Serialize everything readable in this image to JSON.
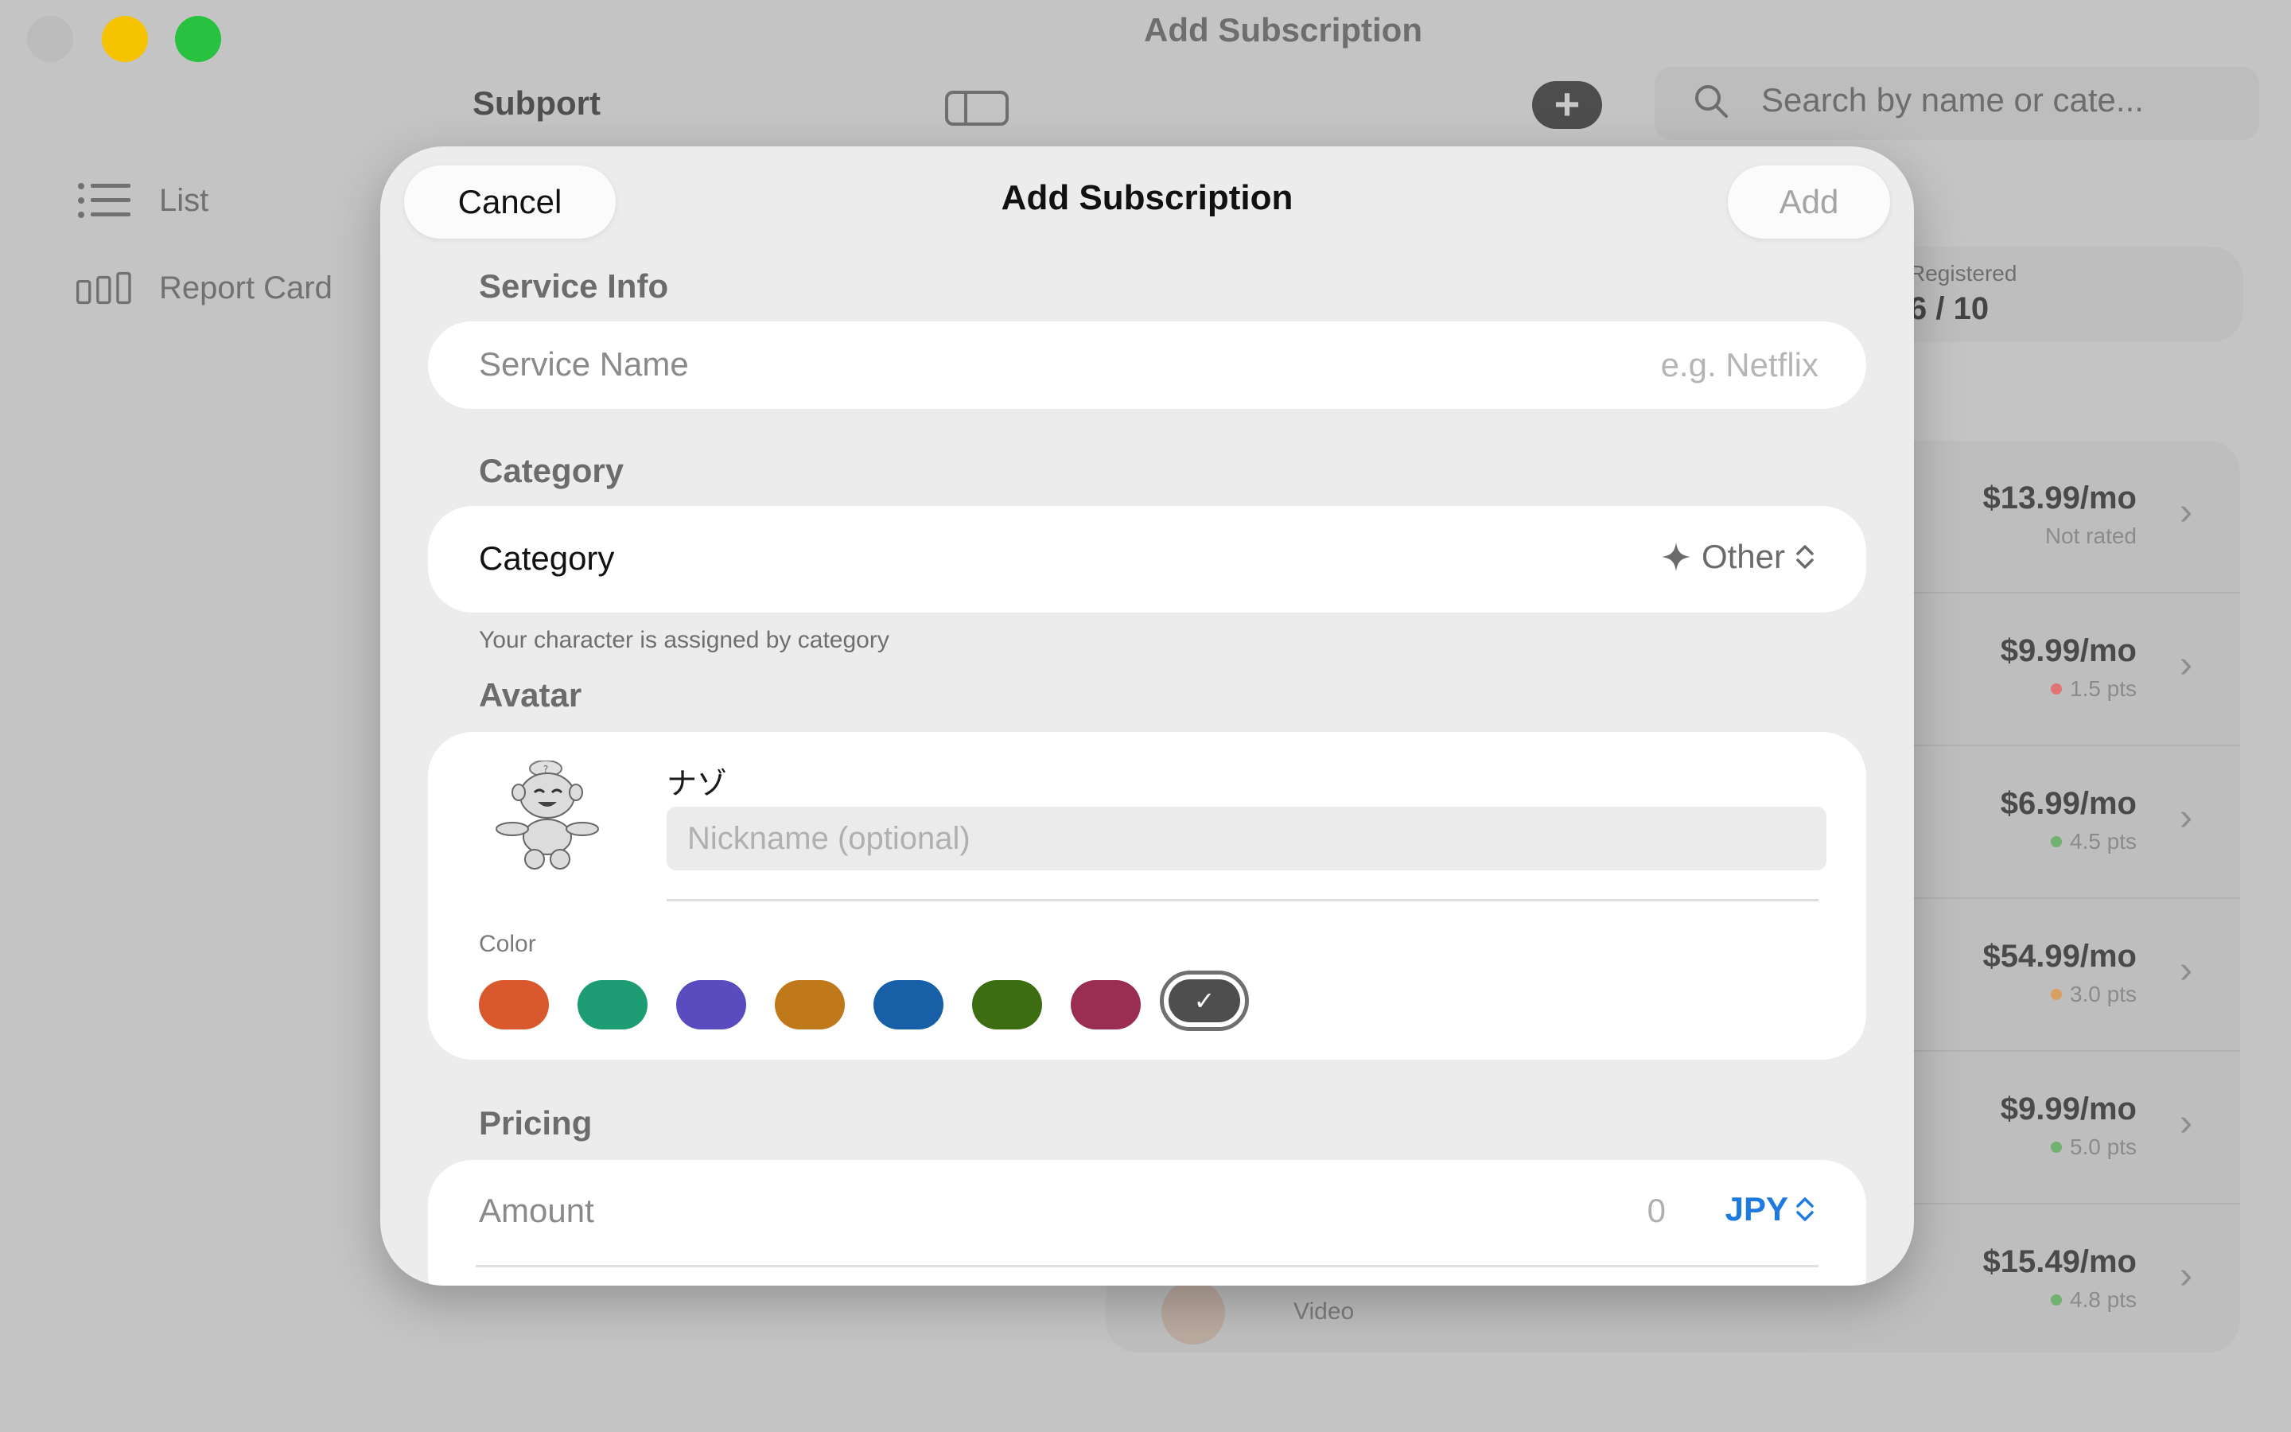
{
  "window": {
    "title": "Add Subscription"
  },
  "toolbar": {
    "app_name": "Subport",
    "search_placeholder": "Search by name or cate..."
  },
  "sidebar": {
    "items": [
      {
        "label": "List"
      },
      {
        "label": "Report Card"
      }
    ]
  },
  "stats": {
    "label": "Registered",
    "value": "6 / 10"
  },
  "subscriptions": [
    {
      "price": "$13.99/mo",
      "rating": "Not rated",
      "dot_color": ""
    },
    {
      "price": "$9.99/mo",
      "rating": "1.5 pts",
      "dot_color": "#e07474"
    },
    {
      "price": "$6.99/mo",
      "rating": "4.5 pts",
      "dot_color": "#6fb36f"
    },
    {
      "price": "$54.99/mo",
      "rating": "3.0 pts",
      "dot_color": "#d9a062"
    },
    {
      "price": "$9.99/mo",
      "rating": "5.0 pts",
      "dot_color": "#6fb36f"
    },
    {
      "price": "$15.49/mo",
      "rating": "4.8 pts",
      "dot_color": "#6fb36f",
      "category": "Video"
    }
  ],
  "modal": {
    "title": "Add Subscription",
    "cancel_label": "Cancel",
    "add_label": "Add",
    "service_info": {
      "section_title": "Service Info",
      "name_label": "Service Name",
      "name_value": "",
      "name_placeholder": "e.g. Netflix"
    },
    "category": {
      "section_title": "Category",
      "label": "Category",
      "selected": "Other",
      "selected_icon": "sparkle-icon",
      "note": "Your character is assigned by category"
    },
    "avatar": {
      "section_title": "Avatar",
      "character_name": "ナゾ",
      "nickname_value": "",
      "nickname_placeholder": "Nickname (optional)",
      "color_label": "Color",
      "colors": [
        "#d9582e",
        "#1e9c74",
        "#5a4bbf",
        "#c0791a",
        "#1760a8",
        "#3d6d12",
        "#992e52",
        "#4e4e4e"
      ],
      "selected_color_index": 7
    },
    "pricing": {
      "section_title": "Pricing",
      "amount_label": "Amount",
      "amount_value": "0",
      "currency": "JPY"
    }
  }
}
